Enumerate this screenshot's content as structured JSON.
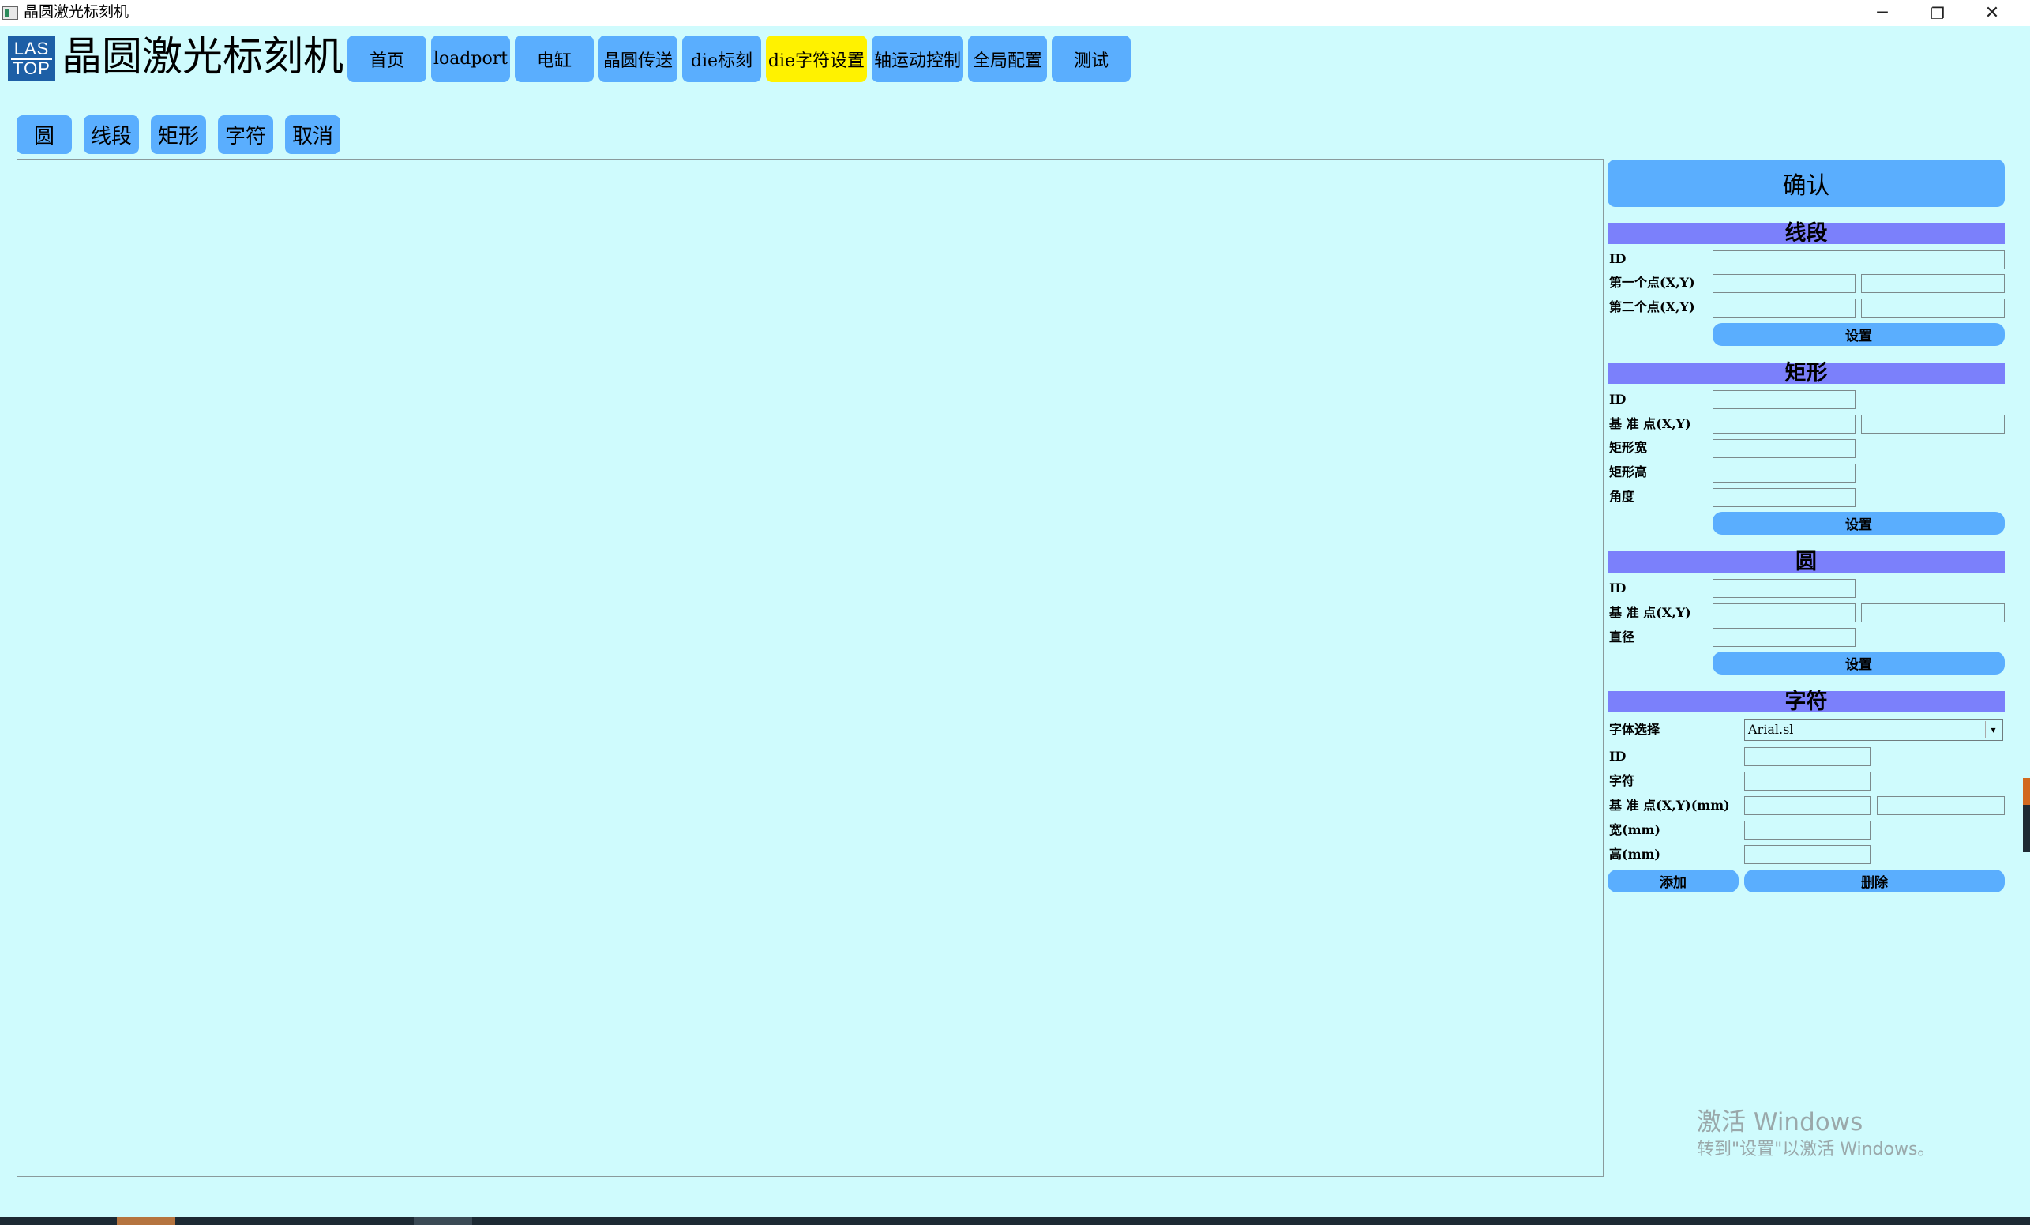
{
  "window": {
    "title": "晶圆激光标刻机",
    "minimize_icon": "─",
    "restore_icon": "❐",
    "close_icon": "✕"
  },
  "header": {
    "logo_line1": "LAS",
    "logo_line2": "TOP",
    "app_name": "晶圆激光标刻机"
  },
  "nav": {
    "items": [
      {
        "label": "首页"
      },
      {
        "label": "loadport"
      },
      {
        "label": "电缸"
      },
      {
        "label": "晶圆传送"
      },
      {
        "label": "die标刻"
      },
      {
        "label": "die字符设置",
        "active": true
      },
      {
        "label": "轴运动控制"
      },
      {
        "label": "全局配置"
      },
      {
        "label": "测试"
      }
    ],
    "active_color": "#fff200",
    "button_color": "#5aaefe"
  },
  "tools": {
    "items": [
      {
        "label": "圆"
      },
      {
        "label": "线段"
      },
      {
        "label": "矩形"
      },
      {
        "label": "字符"
      },
      {
        "label": "取消"
      }
    ]
  },
  "panel": {
    "confirm_label": "确认",
    "line": {
      "title": "线段",
      "id_label": "ID",
      "p1_label": "第一个点(X,Y)",
      "p2_label": "第二个点(X,Y)",
      "set_label": "设置"
    },
    "rect": {
      "title": "矩形",
      "id_label": "ID",
      "base_label": "基 准 点(X,Y)",
      "width_label": "矩形宽",
      "height_label": "矩形高",
      "angle_label": "角度",
      "set_label": "设置"
    },
    "circle": {
      "title": "圆",
      "id_label": "ID",
      "base_label": "基 准 点(X,Y)",
      "diameter_label": "直径",
      "set_label": "设置"
    },
    "char": {
      "title": "字符",
      "font_label": "字体选择",
      "font_value": "Arial.sl",
      "id_label": "ID",
      "char_label": "字符",
      "base_label": "基 准 点(X,Y)(mm)",
      "width_label": "宽(mm)",
      "height_label": "高(mm)",
      "add_label": "添加",
      "delete_label": "删除"
    },
    "header_color": "#7b80fb"
  },
  "watermark": {
    "line1": "激活 Windows",
    "line2": "转到\"设置\"以激活 Windows。"
  }
}
